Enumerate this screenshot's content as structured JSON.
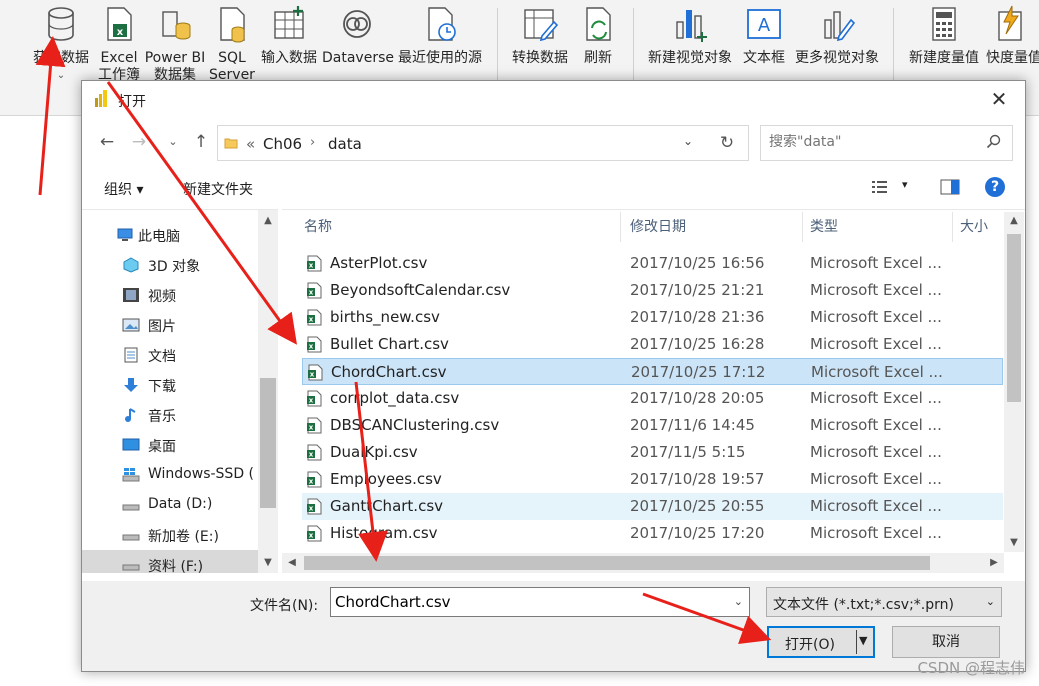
{
  "ribbon": {
    "items": [
      {
        "label": "获取数据",
        "icon": "database-icon"
      },
      {
        "label": "Excel\n工作簿",
        "icon": "excel-icon"
      },
      {
        "label": "Power BI\n数据集",
        "icon": "powerbi-dataset-icon"
      },
      {
        "label": "SQL\nServer",
        "icon": "sql-server-icon"
      },
      {
        "label": "输入数据",
        "icon": "table-enter-icon"
      },
      {
        "label": "Dataverse",
        "icon": "dataverse-icon"
      },
      {
        "label": "最近使用的源",
        "icon": "recent-sources-icon"
      },
      {
        "label": "转换数据",
        "icon": "transform-data-icon"
      },
      {
        "label": "刷新",
        "icon": "refresh-icon"
      },
      {
        "label": "新建视觉对象",
        "icon": "new-visual-icon"
      },
      {
        "label": "文本框",
        "icon": "textbox-icon"
      },
      {
        "label": "更多视觉对象",
        "icon": "more-visuals-icon"
      },
      {
        "label": "新建度量值",
        "icon": "calculator-icon"
      },
      {
        "label": "快度量值",
        "icon": "quick-measure-icon"
      }
    ]
  },
  "dialog": {
    "title": "打开",
    "address": {
      "root_marker": "«",
      "crumbs": [
        "Ch06",
        "data"
      ]
    },
    "search_placeholder": "搜索\"data\"",
    "toolbar": {
      "organize": "组织 ▾",
      "new_folder": "新建文件夹"
    },
    "tree": [
      {
        "label": "此电脑",
        "icon": "computer-icon"
      },
      {
        "label": "3D 对象",
        "icon": "3d-objects-icon"
      },
      {
        "label": "视频",
        "icon": "video-icon"
      },
      {
        "label": "图片",
        "icon": "pictures-icon"
      },
      {
        "label": "文档",
        "icon": "documents-icon"
      },
      {
        "label": "下载",
        "icon": "download-icon"
      },
      {
        "label": "音乐",
        "icon": "music-icon"
      },
      {
        "label": "桌面",
        "icon": "desktop-icon"
      },
      {
        "label": "Windows-SSD (",
        "icon": "windows-drive-icon"
      },
      {
        "label": "Data (D:)",
        "icon": "drive-icon"
      },
      {
        "label": "新加卷 (E:)",
        "icon": "drive-icon"
      },
      {
        "label": "资料 (F:)",
        "icon": "drive-icon"
      }
    ],
    "columns": {
      "name": "名称",
      "date": "修改日期",
      "type": "类型",
      "size": "大小"
    },
    "files": [
      {
        "name": "AsterPlot.csv",
        "date": "2017/10/25 16:56",
        "type": "Microsoft Excel ..."
      },
      {
        "name": "BeyondsoftCalendar.csv",
        "date": "2017/10/25 21:21",
        "type": "Microsoft Excel ..."
      },
      {
        "name": "births_new.csv",
        "date": "2017/10/28 21:36",
        "type": "Microsoft Excel ..."
      },
      {
        "name": "Bullet Chart.csv",
        "date": "2017/10/25 16:28",
        "type": "Microsoft Excel ..."
      },
      {
        "name": "ChordChart.csv",
        "date": "2017/10/25 17:12",
        "type": "Microsoft Excel ..."
      },
      {
        "name": "corrplot_data.csv",
        "date": "2017/10/28 20:05",
        "type": "Microsoft Excel ..."
      },
      {
        "name": "DBSCANClustering.csv",
        "date": "2017/11/6 14:45",
        "type": "Microsoft Excel ..."
      },
      {
        "name": "DualKpi.csv",
        "date": "2017/11/5 5:15",
        "type": "Microsoft Excel ..."
      },
      {
        "name": "Employees.csv",
        "date": "2017/10/28 19:57",
        "type": "Microsoft Excel ..."
      },
      {
        "name": "GanttChart.csv",
        "date": "2017/10/25 20:55",
        "type": "Microsoft Excel ..."
      },
      {
        "name": "Histogram.csv",
        "date": "2017/10/25 17:20",
        "type": "Microsoft Excel ..."
      }
    ],
    "selected_file": "ChordChart.csv",
    "filename_label": "文件名(N):",
    "filename_value": "ChordChart.csv",
    "filetype_value": "文本文件 (*.txt;*.csv;*.prn)",
    "open_label": "打开(O)",
    "cancel_label": "取消"
  },
  "watermark": "CSDN @程志伟",
  "colors": {
    "accent": "#0078d7",
    "selection": "#cce4f7",
    "annotation": "#e8201a",
    "excel": "#1d6f42"
  }
}
